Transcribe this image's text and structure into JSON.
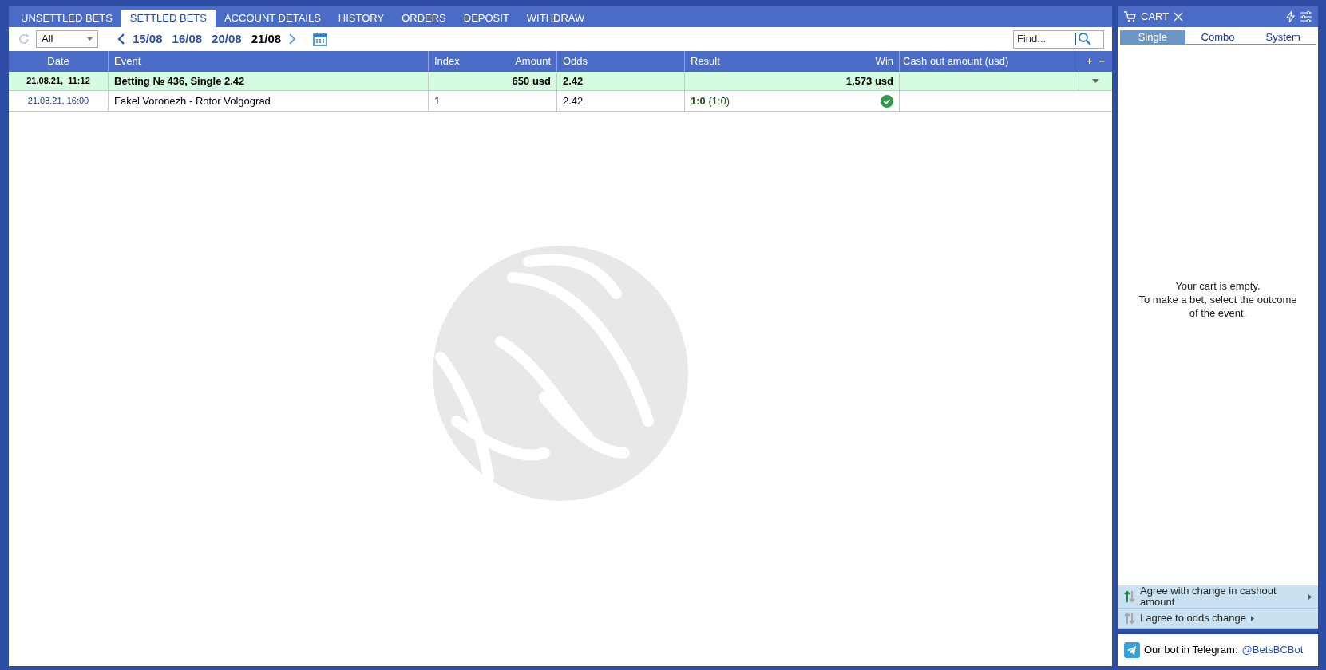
{
  "tabs": [
    {
      "label": "UNSETTLED BETS",
      "selected": false
    },
    {
      "label": "SETTLED BETS",
      "selected": true
    },
    {
      "label": "ACCOUNT DETAILS",
      "selected": false
    },
    {
      "label": "HISTORY",
      "selected": false
    },
    {
      "label": "ORDERS",
      "selected": false
    },
    {
      "label": "DEPOSIT",
      "selected": false
    },
    {
      "label": "WITHDRAW",
      "selected": false
    }
  ],
  "toolbar": {
    "filter": "All",
    "dates": [
      {
        "label": "15/08",
        "selected": false
      },
      {
        "label": "16/08",
        "selected": false
      },
      {
        "label": "20/08",
        "selected": false
      },
      {
        "label": "21/08",
        "selected": true
      }
    ],
    "search": {
      "placeholder": "Find..."
    }
  },
  "table": {
    "columns": [
      "Date",
      "Event",
      "Index",
      "Amount",
      "Odds",
      "Result",
      "Win",
      "Cash out amount (usd)"
    ],
    "expand": "+",
    "collapse": "−",
    "rows": [
      {
        "kind": "bet",
        "date": "21.08.21,  11:12",
        "event": "Betting № 436, Single 2.42",
        "index": "",
        "amount": "650 usd",
        "odds": "2.42",
        "result": "",
        "win": "1,573 usd",
        "won": false
      },
      {
        "kind": "event",
        "date": "21.08.21, 16:00",
        "event": "Fakel Voronezh - Rotor Volgograd",
        "index": "1",
        "amount": "",
        "odds": "2.42",
        "result": "**1:0** (1:0)",
        "win": "",
        "won": true
      }
    ]
  },
  "cart": {
    "title": "CART",
    "tabs": [
      {
        "label": "Single",
        "selected": true
      },
      {
        "label": "Combo",
        "selected": false
      },
      {
        "label": "System",
        "selected": false
      }
    ],
    "empty_message": [
      "Your cart is empty.",
      "To make a bet, select the outcome",
      "of the event."
    ],
    "options": [
      {
        "label": "Agree with change in cashout amount",
        "active": true
      },
      {
        "label": "I agree to odds change",
        "active": false
      }
    ],
    "telegram": {
      "text": "Our bot in Telegram:",
      "link": "@BetsBCBot"
    }
  }
}
